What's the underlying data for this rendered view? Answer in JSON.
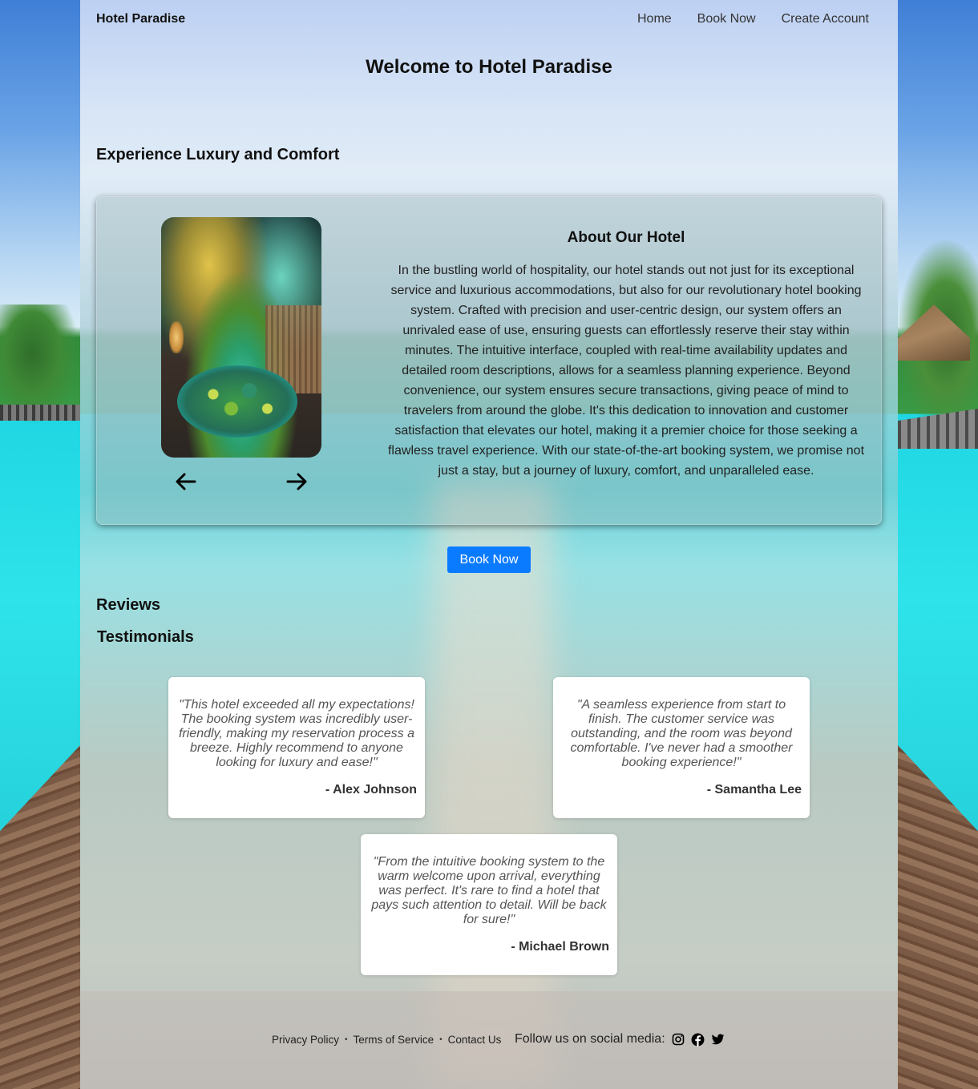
{
  "header": {
    "brand": "Hotel Paradise",
    "nav": [
      "Home",
      "Book Now",
      "Create Account"
    ]
  },
  "page_title": "Welcome to Hotel Paradise",
  "section_heading": "Experience Luxury and Comfort",
  "about": {
    "title": "About Our Hotel",
    "text": "In the bustling world of hospitality, our hotel stands out not just for its exceptional service and luxurious accommodations, but also for our revolutionary hotel booking system. Crafted with precision and user-centric design, our system offers an unrivaled ease of use, ensuring guests can effortlessly reserve their stay within minutes. The intuitive interface, coupled with real-time availability updates and detailed room descriptions, allows for a seamless planning experience. Beyond convenience, our system ensures secure transactions, giving peace of mind to travelers from around the globe. It's this dedication to innovation and customer satisfaction that elevates our hotel, making it a premier choice for those seeking a flawless travel experience. With our state-of-the-art booking system, we promise not just a stay, but a journey of luxury, comfort, and unparalleled ease.",
    "prev_icon": "arrow-left-icon",
    "next_icon": "arrow-right-icon"
  },
  "book_button": "Book Now",
  "reviews_heading": "Reviews",
  "testimonials_heading": "Testimonials",
  "testimonials": [
    {
      "quote": "\"This hotel exceeded all my expectations! The booking system was incredibly user-friendly, making my reservation process a breeze. Highly recommend to anyone looking for luxury and ease!\"",
      "author": "- Alex Johnson"
    },
    {
      "quote": "\"A seamless experience from start to finish. The customer service was outstanding, and the room was beyond comfortable. I've never had a smoother booking experience!\"",
      "author": "- Samantha Lee"
    },
    {
      "quote": "\"From the intuitive booking system to the warm welcome upon arrival, everything was perfect. It's rare to find a hotel that pays such attention to detail. Will be back for sure!\"",
      "author": "- Michael Brown"
    }
  ],
  "footer": {
    "links": [
      "Privacy Policy",
      "Terms of Service",
      "Contact Us"
    ],
    "separator": "•",
    "social_label": "Follow us on social media:",
    "social_icons": [
      "instagram-icon",
      "facebook-icon",
      "twitter-icon"
    ]
  },
  "colors": {
    "accent": "#0a7bff"
  }
}
